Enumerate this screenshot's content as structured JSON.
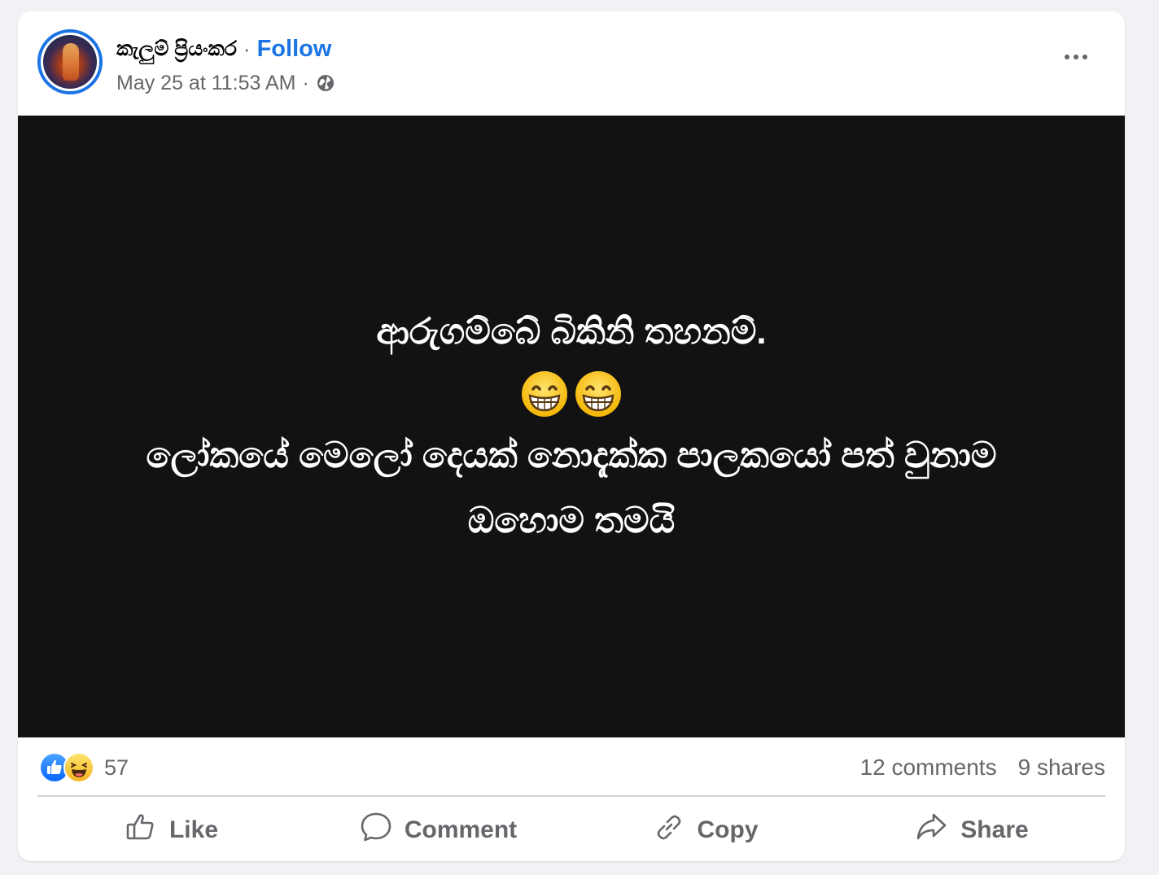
{
  "header": {
    "author": "කැලුම් ප්‍රියංකර",
    "separator": "·",
    "follow_label": "Follow",
    "timestamp": "May 25 at 11:53 AM",
    "meta_separator": "·",
    "privacy_icon": "globe-icon",
    "more_icon": "more-options-icon"
  },
  "post": {
    "line1": "ආරුගම්බේ බිකිනි තහනම්.",
    "emoji": [
      "grinning-face-icon",
      "grinning-face-icon"
    ],
    "line2": "ලෝකයේ මෙලෝ දෙයක් නොදැක්ක පාලකයෝ පත් වුනාම",
    "line3": "ඔහොම තමයි",
    "background": "#121212",
    "text_color": "#ffffff"
  },
  "stats": {
    "reaction_icons": [
      "like-reaction-icon",
      "haha-reaction-icon"
    ],
    "reaction_count": "57",
    "comments": "12 comments",
    "shares": "9 shares"
  },
  "actions": {
    "like": "Like",
    "comment": "Comment",
    "copy": "Copy",
    "share": "Share"
  },
  "colors": {
    "accent": "#1b74e4",
    "secondary_text": "#65676b",
    "page_bg": "#f0f2f5"
  }
}
